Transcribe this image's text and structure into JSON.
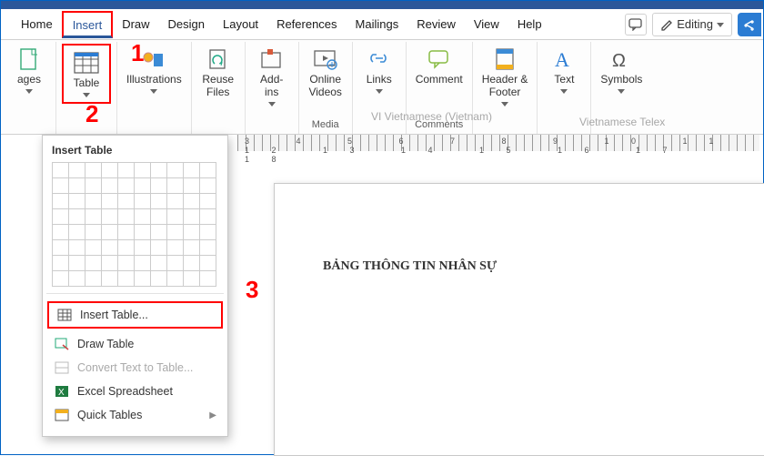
{
  "tabs": {
    "home": "Home",
    "insert": "Insert",
    "draw": "Draw",
    "design": "Design",
    "layout": "Layout",
    "references": "References",
    "mailings": "Mailings",
    "review": "Review",
    "view": "View",
    "help": "Help"
  },
  "headerRight": {
    "editing": "Editing"
  },
  "ribbon": {
    "pages": "ages",
    "table": "Table",
    "illustrations": "Illustrations",
    "reuseFiles": "Reuse\nFiles",
    "addins": "Add-\nins",
    "onlineVideos": "Online\nVideos",
    "links": "Links",
    "comment": "Comment",
    "headerFooter": "Header &\nFooter",
    "text": "Text",
    "symbols": "Symbols",
    "groups": {
      "media": "Media",
      "comments": "Comments"
    },
    "disabled1": "VI  Vietnamese (Vietnam)",
    "disabled2": "Vietnamese Telex"
  },
  "ruler": "3 4 5 6 7 8 9 10 11 12 13 14 15 16 17 18",
  "document": {
    "title": "BẢNG THÔNG TIN NHÂN SỰ"
  },
  "dropdown": {
    "title": "Insert Table",
    "insertTable": "Insert Table...",
    "drawTable": "Draw Table",
    "convert": "Convert Text to Table...",
    "excel": "Excel Spreadsheet",
    "quick": "Quick Tables"
  },
  "annotations": {
    "n1": "1",
    "n2": "2",
    "n3": "3"
  }
}
